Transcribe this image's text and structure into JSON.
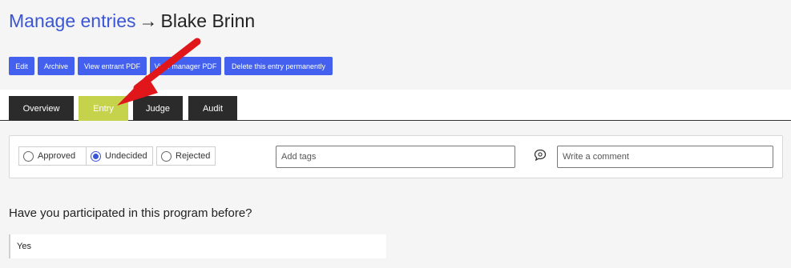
{
  "header": {
    "crumb": "Manage entries",
    "arrow": "→",
    "entrant": "Blake Brinn"
  },
  "actions": {
    "edit": "Edit",
    "archive": "Archive",
    "view_entrant_pdf": "View entrant PDF",
    "view_manager_pdf": "View manager PDF",
    "delete": "Delete this entry permanently"
  },
  "tabs": {
    "overview": "Overview",
    "entry": "Entry",
    "judge": "Judge",
    "audit": "Audit",
    "active": "Entry"
  },
  "status": {
    "approved": "Approved",
    "undecided": "Undecided",
    "rejected": "Rejected",
    "selected": "Undecided"
  },
  "tags": {
    "placeholder": "Add tags"
  },
  "comment": {
    "placeholder": "Write a comment"
  },
  "question": {
    "label": "Have you participated in this program before?",
    "answer": "Yes"
  },
  "colors": {
    "accent": "#4361ee",
    "link": "#3a55d6",
    "tab_dark": "#2b2b2b",
    "tab_active": "#c5d24b",
    "annotation": "#e0161b"
  },
  "icons": {
    "comment": "speech-bubble-icon",
    "annotation": "red-pointer-arrow"
  }
}
